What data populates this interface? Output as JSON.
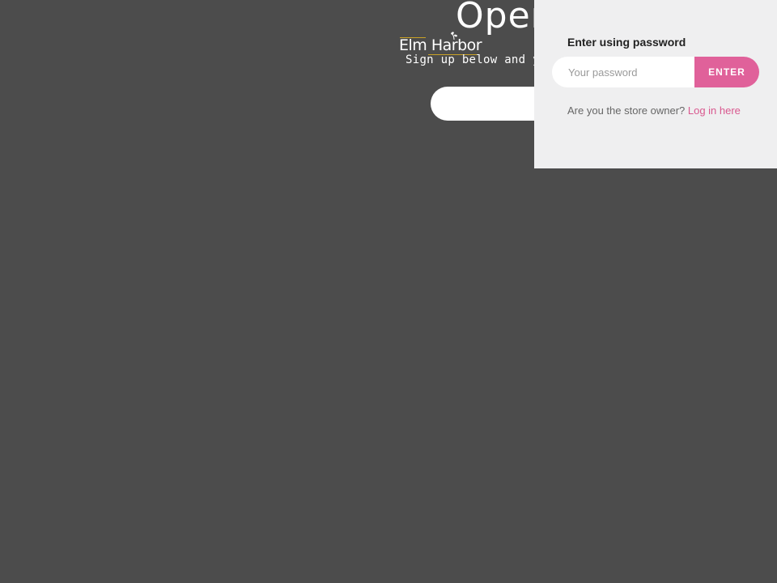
{
  "hero": {
    "title": "Oper",
    "subtitle": "Sign up below and yo"
  },
  "logo": {
    "text": "Elm Harbor",
    "accent_color": "#c9a227"
  },
  "signup": {
    "placeholder": ""
  },
  "password_panel": {
    "heading": "Enter using password",
    "input_placeholder": "Your password",
    "enter_label": "ENTER",
    "owner_prompt": "Are you the store owner? ",
    "login_link": "Log in here"
  },
  "colors": {
    "background": "#4c4c4c",
    "panel": "#efeff0",
    "accent": "#e0619a"
  },
  "icons": {
    "logo_mark": "leaf-icon"
  }
}
